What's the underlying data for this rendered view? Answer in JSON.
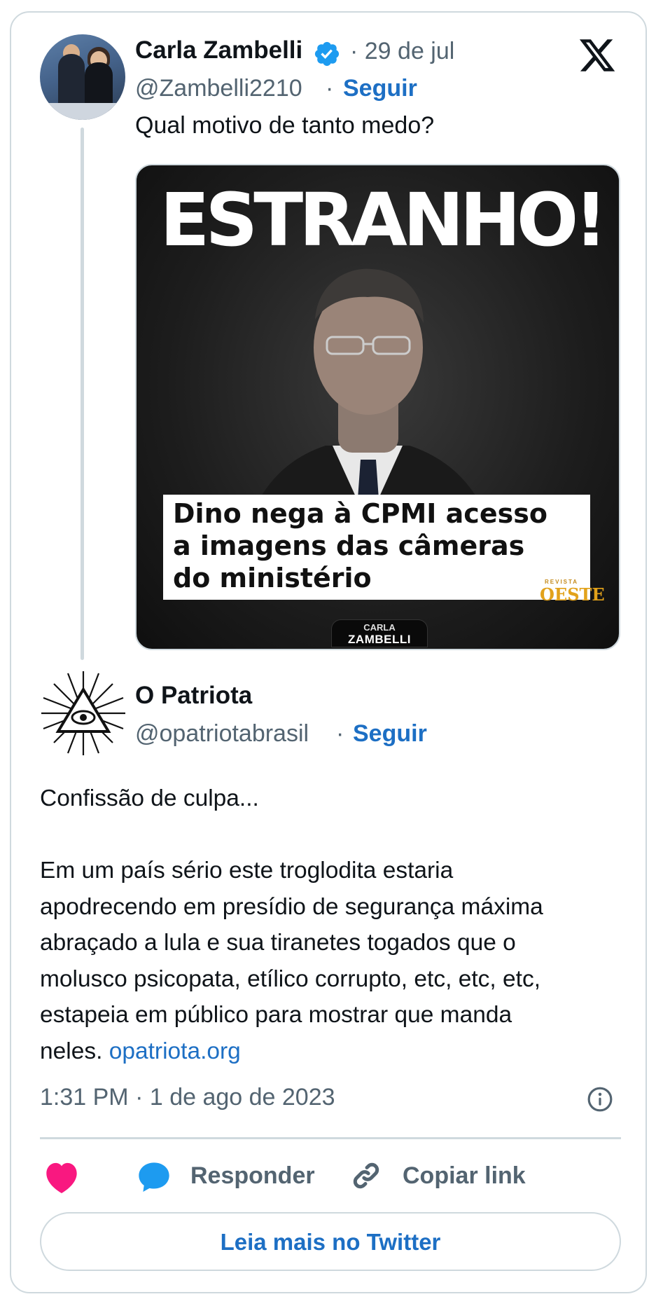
{
  "quoted_tweet": {
    "author_name": "Carla Zambelli",
    "date": "· 29 de jul",
    "handle": "@Zambelli2210",
    "separator": "·",
    "follow_label": "Seguir",
    "text": "Qual motivo de tanto medo?",
    "verified_color": "#1d9bf0",
    "media": {
      "headline": "ESTRANHO!",
      "caption": "Dino nega à CPMI acesso a imagens das câmeras do ministério",
      "publisher_small": "REVISTA",
      "publisher": "OESTE",
      "badge_top": "CARLA",
      "badge_bottom": "ZAMBELLI"
    }
  },
  "tweet": {
    "author_name": "O Patriota",
    "handle": "@opatriotabrasil",
    "separator": "·",
    "follow_label": "Seguir",
    "paragraph1": "Confissão de culpa...",
    "lines": [
      "Em um país sério este troglodita estaria",
      "apodrecendo em presídio de segurança máxima",
      "abraçado a lula e sua tiranetes togados que o",
      "molusco psicopata, etílico corrupto, etc, etc, etc,",
      "estapeia em público para mostrar que manda"
    ],
    "last_line_prefix": "neles.",
    "link_text": "opatriota.org",
    "timestamp": "1:31 PM · 1 de ago de 2023"
  },
  "actions": {
    "reply_label": "Responder",
    "copy_link_label": "Copiar link",
    "heart_color": "#f91880",
    "reply_color": "#1d9bf0"
  },
  "read_more_label": "Leia mais no Twitter",
  "colors": {
    "link": "#1d6fc4",
    "secondary_text": "#536471",
    "border": "#cfd9de"
  }
}
